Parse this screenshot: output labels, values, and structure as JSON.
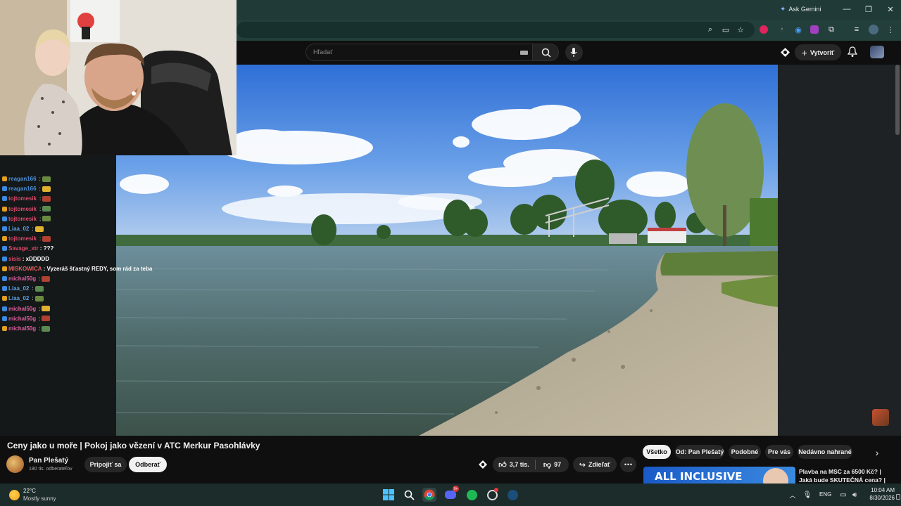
{
  "browser": {
    "ask_gemini": "Ask Gemini"
  },
  "youtube": {
    "search_placeholder": "Hľadať",
    "create_label": "Vytvoriť"
  },
  "video": {
    "title": "Ceny jako u moře | Pokoj jako vězení v ATC Merkur Pasohlávky"
  },
  "channel": {
    "name": "Pan Plešatý",
    "subscribers": "180 tis. odberateľov",
    "join_label": "Pripojiť sa",
    "subscribe_label": "Odberať"
  },
  "actions": {
    "like_count": "3,7 tis.",
    "dislike_count": "97",
    "share_label": "Zdieľať"
  },
  "filter_chips": [
    "Všetko",
    "Od: Pan Plešatý",
    "Podobné",
    "Pre vás",
    "Nedávno nahrané"
  ],
  "recommended": {
    "thumb_text": "ALL INCLUSIVE",
    "title_line1": "Plavba na MSC za 6500 Kč? |",
    "title_line2": "Jaká bude SKUTEČNÁ cena? |"
  },
  "chat": [
    {
      "user": "reagan166",
      "text": "",
      "color": "#4a90d9"
    },
    {
      "user": "reagan166",
      "text": "",
      "color": "#4a90d9"
    },
    {
      "user": "tojtomesik",
      "text": "",
      "color": "#d94a6a"
    },
    {
      "user": "tojtomesik",
      "text": "",
      "color": "#d94a6a"
    },
    {
      "user": "tojtomesik",
      "text": "",
      "color": "#d94a6a"
    },
    {
      "user": "Liaa_02",
      "text": "",
      "color": "#5aa0e0"
    },
    {
      "user": "tojtomesik",
      "text": "",
      "color": "#d94a6a"
    },
    {
      "user": "Savage_xtr",
      "text": ": ???",
      "color": "#d94a6a"
    },
    {
      "user": "sisis",
      "text": ": xDDDDD",
      "color": "#d94a6a"
    },
    {
      "user": "MISKOWICA",
      "text": ": Vyzeráš šťastný REDY, som rád za teba",
      "color": "#e06060"
    },
    {
      "user": "michal50g",
      "text": "",
      "color": "#e060a0"
    },
    {
      "user": "Liaa_02",
      "text": "",
      "color": "#5aa0e0"
    },
    {
      "user": "Liaa_02",
      "text": "",
      "color": "#5aa0e0"
    },
    {
      "user": "michal50g",
      "text": "",
      "color": "#e060a0"
    },
    {
      "user": "michal50g",
      "text": "",
      "color": "#e060a0"
    },
    {
      "user": "michal50g",
      "text": "",
      "color": "#e060a0"
    }
  ],
  "taskbar": {
    "temperature": "22°C",
    "weather": "Mostly sunny",
    "language": "ENG",
    "time": "10:04 AM",
    "date": "8/30/2026"
  }
}
